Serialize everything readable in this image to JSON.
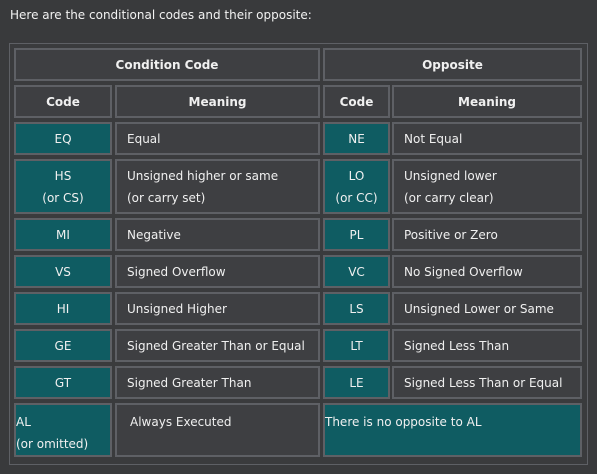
{
  "intro": "Here are the conditional codes and their opposite:",
  "headers": {
    "condition": "Condition Code",
    "opposite": "Opposite",
    "code": "Code",
    "meaning": "Meaning",
    "code2": "Code",
    "meaning2": "Meaning"
  },
  "rows": [
    {
      "code": [
        "EQ"
      ],
      "meaning": [
        "Equal"
      ],
      "opp_code": [
        "NE"
      ],
      "opp_meaning": [
        "Not Equal"
      ]
    },
    {
      "code": [
        "HS",
        "(or CS)"
      ],
      "meaning": [
        "Unsigned higher or same",
        "(or carry set)"
      ],
      "opp_code": [
        "LO",
        "(or CC)"
      ],
      "opp_meaning": [
        "Unsigned lower",
        "(or carry clear)"
      ]
    },
    {
      "code": [
        "MI"
      ],
      "meaning": [
        "Negative"
      ],
      "opp_code": [
        "PL"
      ],
      "opp_meaning": [
        "Positive or Zero"
      ]
    },
    {
      "code": [
        "VS"
      ],
      "meaning": [
        "Signed Overflow"
      ],
      "opp_code": [
        "VC"
      ],
      "opp_meaning": [
        "No Signed Overflow"
      ]
    },
    {
      "code": [
        "HI"
      ],
      "meaning": [
        "Unsigned Higher"
      ],
      "opp_code": [
        "LS"
      ],
      "opp_meaning": [
        "Unsigned Lower or Same"
      ]
    },
    {
      "code": [
        "GE"
      ],
      "meaning": [
        "Signed Greater Than or Equal"
      ],
      "opp_code": [
        "LT"
      ],
      "opp_meaning": [
        "Signed Less Than"
      ]
    },
    {
      "code": [
        "GT"
      ],
      "meaning": [
        "Signed Greater Than"
      ],
      "opp_code": [
        "LE"
      ],
      "opp_meaning": [
        "Signed Less Than or Equal"
      ]
    }
  ],
  "last_row": {
    "code": [
      "AL",
      "(or omitted)"
    ],
    "meaning": "Always Executed",
    "opposite": "There is no opposite to AL"
  },
  "colors": {
    "background": "#393a3c",
    "cell": "#3e3f42",
    "code_cell": "#0f5c62",
    "border": "#5e6065",
    "text": "#f0f0f0"
  }
}
